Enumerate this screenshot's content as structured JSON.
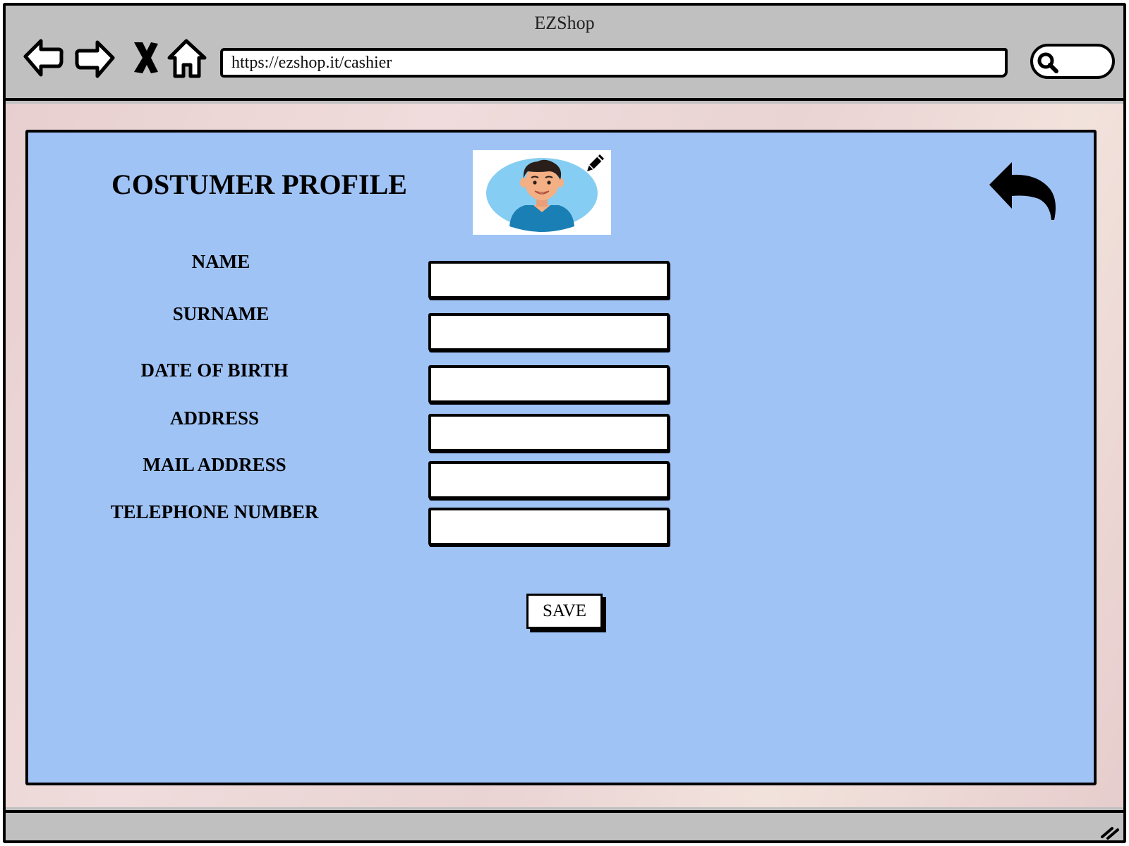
{
  "window": {
    "title": "EZShop"
  },
  "browser": {
    "url": "https://ezshop.it/cashier",
    "icons": [
      "back-arrow-icon",
      "forward-arrow-icon",
      "stop-icon",
      "home-icon",
      "search-icon"
    ]
  },
  "page": {
    "title": "COSTUMER PROFILE",
    "avatar_icon": "user-avatar",
    "edit_icon": "pencil-icon",
    "back_icon": "undo-arrow-icon"
  },
  "form": {
    "fields": [
      {
        "label": "NAME",
        "value": ""
      },
      {
        "label": "SURNAME",
        "value": ""
      },
      {
        "label": "DATE OF BIRTH",
        "value": ""
      },
      {
        "label": "ADDRESS",
        "value": ""
      },
      {
        "label": "MAIL ADDRESS",
        "value": ""
      },
      {
        "label": "TELEPHONE NUMBER",
        "value": ""
      }
    ],
    "save_label": "SAVE"
  },
  "colors": {
    "panel": "#a0c3f6",
    "chrome": "#c0c0c0",
    "avatar_bg": "#85cdf2",
    "shirt": "#1a7fb4"
  }
}
